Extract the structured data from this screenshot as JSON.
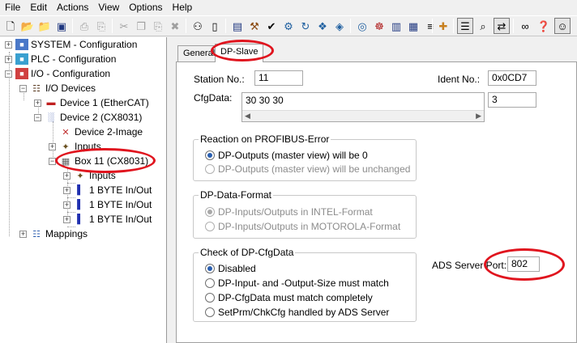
{
  "menu": [
    "File",
    "Edit",
    "Actions",
    "View",
    "Options",
    "Help"
  ],
  "toolbar_icons": [
    "new-file-icon",
    "open-folder-icon",
    "open-file-icon",
    "save-icon",
    "print-icon",
    "print-preview-icon",
    "cut-icon",
    "copy-icon",
    "paste-icon",
    "delete-icon",
    "find-icon",
    "find-next-icon",
    "monitor-icon",
    "build-icon",
    "check-icon",
    "activate-config-icon",
    "restart-icon",
    "config-mode-icon",
    "free-run-icon",
    "target-icon",
    "network-icon",
    "scan-icon",
    "io-icon",
    "tree-icon",
    "add-icon",
    "list-view-icon",
    "zoom-icon",
    "online-icon",
    "glasses-icon",
    "help-icon"
  ],
  "tree": {
    "items": [
      {
        "label": "SYSTEM - Configuration"
      },
      {
        "label": "PLC - Configuration"
      },
      {
        "label": "I/O - Configuration"
      },
      {
        "label": "I/O Devices"
      },
      {
        "label": "Device 1 (EtherCAT)"
      },
      {
        "label": "Device 2 (CX8031)"
      },
      {
        "label": "Device 2-Image"
      },
      {
        "label": "Inputs"
      },
      {
        "label": "Box 11 (CX8031)"
      },
      {
        "label": "Inputs"
      },
      {
        "label": "1 BYTE In/Out"
      },
      {
        "label": "1 BYTE In/Out"
      },
      {
        "label": "1 BYTE In/Out"
      },
      {
        "label": "Mappings"
      }
    ]
  },
  "tabs": [
    {
      "label": "General"
    },
    {
      "label": "DP-Slave"
    }
  ],
  "panel": {
    "station_label": "Station No.:",
    "station_value": "11",
    "ident_label": "Ident No.:",
    "ident_value": "0x0CD7",
    "cfgdata_label": "CfgData:",
    "cfgdata_value": "30 30 30",
    "cfgdata_count": "3",
    "reaction": {
      "title": "Reaction on PROFIBUS-Error",
      "options": [
        {
          "label": "DP-Outputs (master view) will be 0",
          "checked": true
        },
        {
          "label": "DP-Outputs (master view) will be unchanged",
          "checked": false
        }
      ]
    },
    "format": {
      "title": "DP-Data-Format",
      "options": [
        {
          "label": "DP-Inputs/Outputs in INTEL-Format",
          "checked": true
        },
        {
          "label": "DP-Inputs/Outputs in MOTOROLA-Format",
          "checked": false
        }
      ]
    },
    "check": {
      "title": "Check of DP-CfgData",
      "options": [
        {
          "label": "Disabled",
          "checked": true
        },
        {
          "label": "DP-Input- and -Output-Size must match",
          "checked": false
        },
        {
          "label": "DP-CfgData must match completely",
          "checked": false
        },
        {
          "label": "SetPrm/ChkCfg handled by ADS Server",
          "checked": false
        }
      ]
    },
    "ads_label": "ADS Server Port:",
    "ads_value": "802"
  },
  "colors": {
    "highlight_ellipse": "#e0141e",
    "radio_selected": "#2a5fb0"
  }
}
